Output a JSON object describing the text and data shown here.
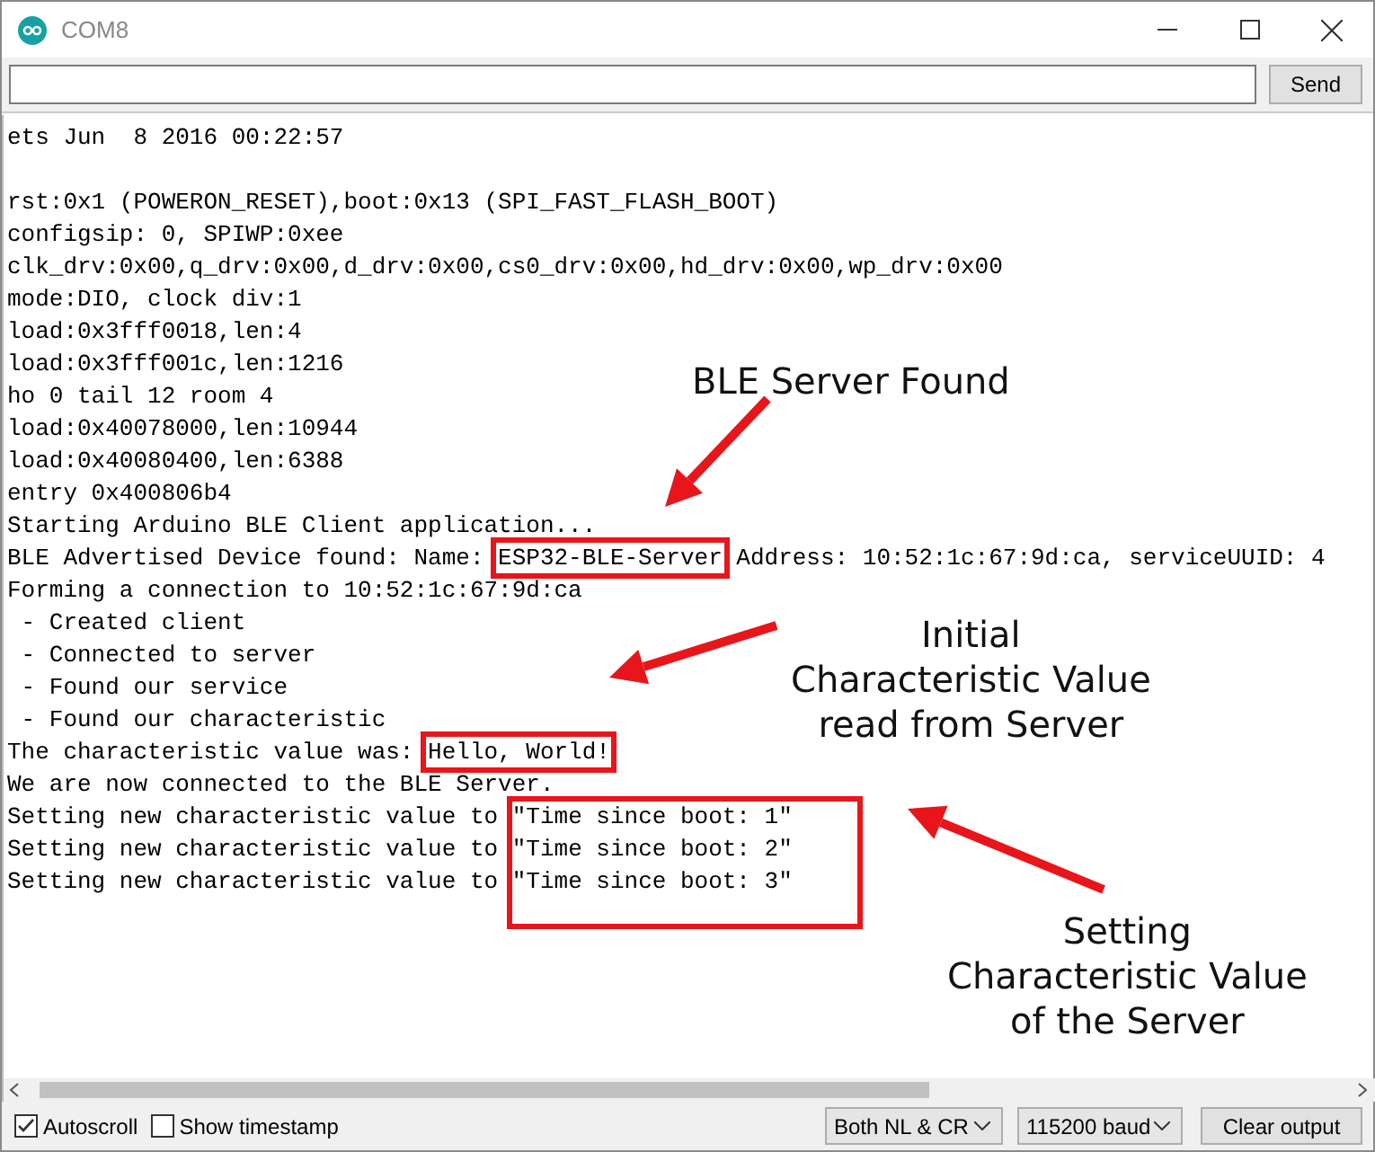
{
  "window": {
    "title": "COM8"
  },
  "send": {
    "button": "Send"
  },
  "output": {
    "lines": [
      {
        "kind": "text",
        "parts": [
          {
            "kind": "plain",
            "text": "ets Jun  8 2016 00:22:57"
          }
        ]
      },
      {
        "kind": "blank"
      },
      {
        "kind": "text",
        "parts": [
          {
            "kind": "plain",
            "text": "rst:0x1 (POWERON_RESET),boot:0x13 (SPI_FAST_FLASH_BOOT)"
          }
        ]
      },
      {
        "kind": "text",
        "parts": [
          {
            "kind": "plain",
            "text": "configsip: 0, SPIWP:0xee"
          }
        ]
      },
      {
        "kind": "text",
        "parts": [
          {
            "kind": "plain",
            "text": "clk_drv:0x00,q_drv:0x00,d_drv:0x00,cs0_drv:0x00,hd_drv:0x00,wp_drv:0x00"
          }
        ]
      },
      {
        "kind": "text",
        "parts": [
          {
            "kind": "plain",
            "text": "mode:DIO, clock div:1"
          }
        ]
      },
      {
        "kind": "text",
        "parts": [
          {
            "kind": "plain",
            "text": "load:0x3fff0018,len:4"
          }
        ]
      },
      {
        "kind": "text",
        "parts": [
          {
            "kind": "plain",
            "text": "load:0x3fff001c,len:1216"
          }
        ]
      },
      {
        "kind": "text",
        "parts": [
          {
            "kind": "plain",
            "text": "ho 0 tail 12 room 4"
          }
        ]
      },
      {
        "kind": "text",
        "parts": [
          {
            "kind": "plain",
            "text": "load:0x40078000,len:10944"
          }
        ]
      },
      {
        "kind": "text",
        "parts": [
          {
            "kind": "plain",
            "text": "load:0x40080400,len:6388"
          }
        ]
      },
      {
        "kind": "text",
        "parts": [
          {
            "kind": "plain",
            "text": "entry 0x400806b4"
          }
        ]
      },
      {
        "kind": "text",
        "parts": [
          {
            "kind": "plain",
            "text": "Starting Arduino BLE Client application..."
          }
        ]
      },
      {
        "kind": "text",
        "parts": [
          {
            "kind": "plain",
            "text": "BLE Advertised Device found: Name: "
          },
          {
            "kind": "boxed",
            "text": "ESP32-BLE-Server"
          },
          {
            "kind": "plain",
            "text": " Address: 10:52:1c:67:9d:ca, serviceUUID: 4"
          }
        ]
      },
      {
        "kind": "text",
        "parts": [
          {
            "kind": "plain",
            "text": "Forming a connection to 10:52:1c:67:9d:ca"
          }
        ]
      },
      {
        "kind": "text",
        "parts": [
          {
            "kind": "plain",
            "text": " - Created client"
          }
        ]
      },
      {
        "kind": "text",
        "parts": [
          {
            "kind": "plain",
            "text": " - Connected to server"
          }
        ]
      },
      {
        "kind": "text",
        "parts": [
          {
            "kind": "plain",
            "text": " - Found our service"
          }
        ]
      },
      {
        "kind": "text",
        "parts": [
          {
            "kind": "plain",
            "text": " - Found our characteristic"
          }
        ]
      },
      {
        "kind": "text",
        "parts": [
          {
            "kind": "plain",
            "text": "The characteristic value was: "
          },
          {
            "kind": "boxed",
            "text": "Hello, World!"
          }
        ]
      },
      {
        "kind": "text",
        "parts": [
          {
            "kind": "plain",
            "text": "We are now connected to the BLE Server."
          }
        ]
      },
      {
        "kind": "text",
        "parts": [
          {
            "kind": "plain",
            "text": "Setting new characteristic value to "
          },
          {
            "kind": "grouped",
            "text": "\"Time since boot: 1\""
          }
        ]
      },
      {
        "kind": "text",
        "parts": [
          {
            "kind": "plain",
            "text": "Setting new characteristic value to "
          },
          {
            "kind": "grouped",
            "text": "\"Time since boot: 2\""
          }
        ]
      },
      {
        "kind": "text",
        "parts": [
          {
            "kind": "plain",
            "text": "Setting new characteristic value to "
          },
          {
            "kind": "grouped",
            "text": "\"Time since boot: 3\""
          }
        ]
      }
    ]
  },
  "annotations": [
    {
      "lines": [
        "BLE Server Found"
      ]
    },
    {
      "lines": [
        "Initial",
        "Characteristic Value",
        "read from Server"
      ]
    },
    {
      "lines": [
        "Setting",
        "Characteristic Value",
        "of the Server"
      ]
    }
  ],
  "footer": {
    "autoscroll": {
      "label": "Autoscroll",
      "checked": true
    },
    "timestamp": {
      "label": "Show timestamp",
      "checked": false
    },
    "line_ending": "Both NL & CR",
    "baud": "115200 baud",
    "clear_button": "Clear output"
  }
}
